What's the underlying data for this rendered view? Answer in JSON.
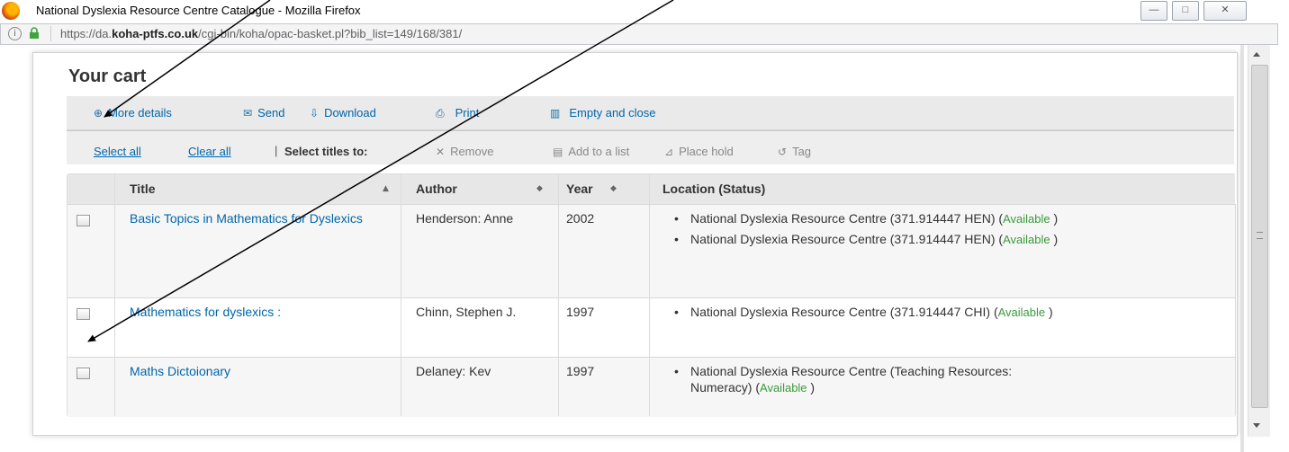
{
  "window": {
    "title": "National Dyslexia Resource Centre Catalogue - Mozilla Firefox",
    "minimize_glyph": "—",
    "maximize_glyph": "□",
    "close_glyph": "✕"
  },
  "urlbar": {
    "url_prefix": "https://da.",
    "url_domain": "koha-ptfs.co.uk",
    "url_path": "/cgi-bin/koha/opac-basket.pl?bib_list=149/168/381/"
  },
  "cart": {
    "title": "Your cart",
    "toolbar": {
      "more_details": "More details",
      "send": "Send",
      "download": "Download",
      "print": "Print",
      "empty_and_close": "Empty and close"
    },
    "selection_bar": {
      "select_all": "Select all",
      "clear_all": "Clear all",
      "separator": "|",
      "select_titles_to": "Select titles to:",
      "remove": "Remove",
      "add_to_list": "Add to a list",
      "place_hold": "Place hold",
      "tag": "Tag"
    },
    "table": {
      "columns": [
        "Title",
        "Author",
        "Year",
        "Location (Status)"
      ],
      "sort_title": "▲",
      "sort_author": "◆",
      "sort_year": "◆",
      "rows": [
        {
          "title": "Basic Topics in Mathematics for Dyslexics",
          "author": "Henderson: Anne",
          "year": "2002",
          "locations": [
            {
              "text": "National Dyslexia Resource Centre (371.914447 HEN) (",
              "status": "Available",
              "close": " )"
            },
            {
              "text": "National Dyslexia Resource Centre (371.914447 HEN) (",
              "status": "Available",
              "close": " )"
            }
          ]
        },
        {
          "title": "Mathematics for dyslexics :",
          "author": "Chinn, Stephen J.",
          "year": "1997",
          "locations": [
            {
              "text": "National Dyslexia Resource Centre (371.914447 CHI) (",
              "status": "Available",
              "close": " )"
            }
          ]
        },
        {
          "title": "Maths Dictoionary",
          "author": "Delaney: Kev",
          "year": "1997",
          "locations": [
            {
              "text": "National Dyslexia Resource Centre (Teaching Resources: Numeracy) (",
              "status": "Available",
              "close": " )"
            }
          ]
        }
      ]
    }
  },
  "icons": {
    "more_details": "plus-circle-icon",
    "send": "envelope-icon",
    "download": "download-icon",
    "print": "printer-icon",
    "empty": "trash-icon",
    "remove": "x-icon",
    "add_to_list": "list-icon",
    "place_hold": "hold-icon",
    "tag": "tag-icon"
  },
  "colors": {
    "link": "#0066aa",
    "available": "#3a9a3a",
    "toolbar_bg": "#eaeaea",
    "header_bg": "#e7e7e7"
  }
}
